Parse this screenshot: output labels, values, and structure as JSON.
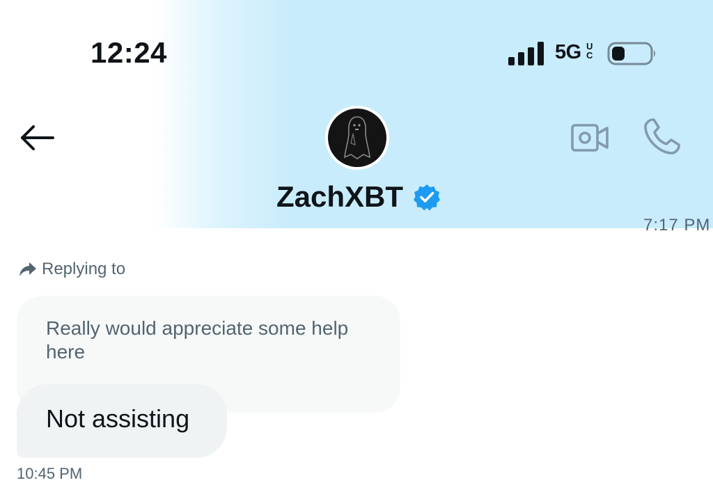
{
  "status_bar": {
    "time": "12:24",
    "network": "5G",
    "network_sub": "UC",
    "battery_icon": "battery-low-icon",
    "signal_icon": "cellular-signal-icon"
  },
  "conversation_header": {
    "back_icon": "arrow-left-icon",
    "avatar_icon": "ghost-avatar",
    "display_name": "ZachXBT",
    "verified_icon": "verified-badge-icon",
    "video_icon": "video-camera-icon",
    "call_icon": "phone-icon"
  },
  "messages": {
    "previous_timestamp_partial": "7:17 PM",
    "replying_label": "Replying to",
    "quoted_text": "Really would appreciate some help here",
    "message_text": "Not assisting",
    "message_time": "10:45 PM"
  },
  "colors": {
    "header_gradient": "#c8ecfc",
    "verified_blue": "#1d9bf0",
    "secondary_text": "#536471",
    "bubble_gray": "#eff3f4"
  }
}
